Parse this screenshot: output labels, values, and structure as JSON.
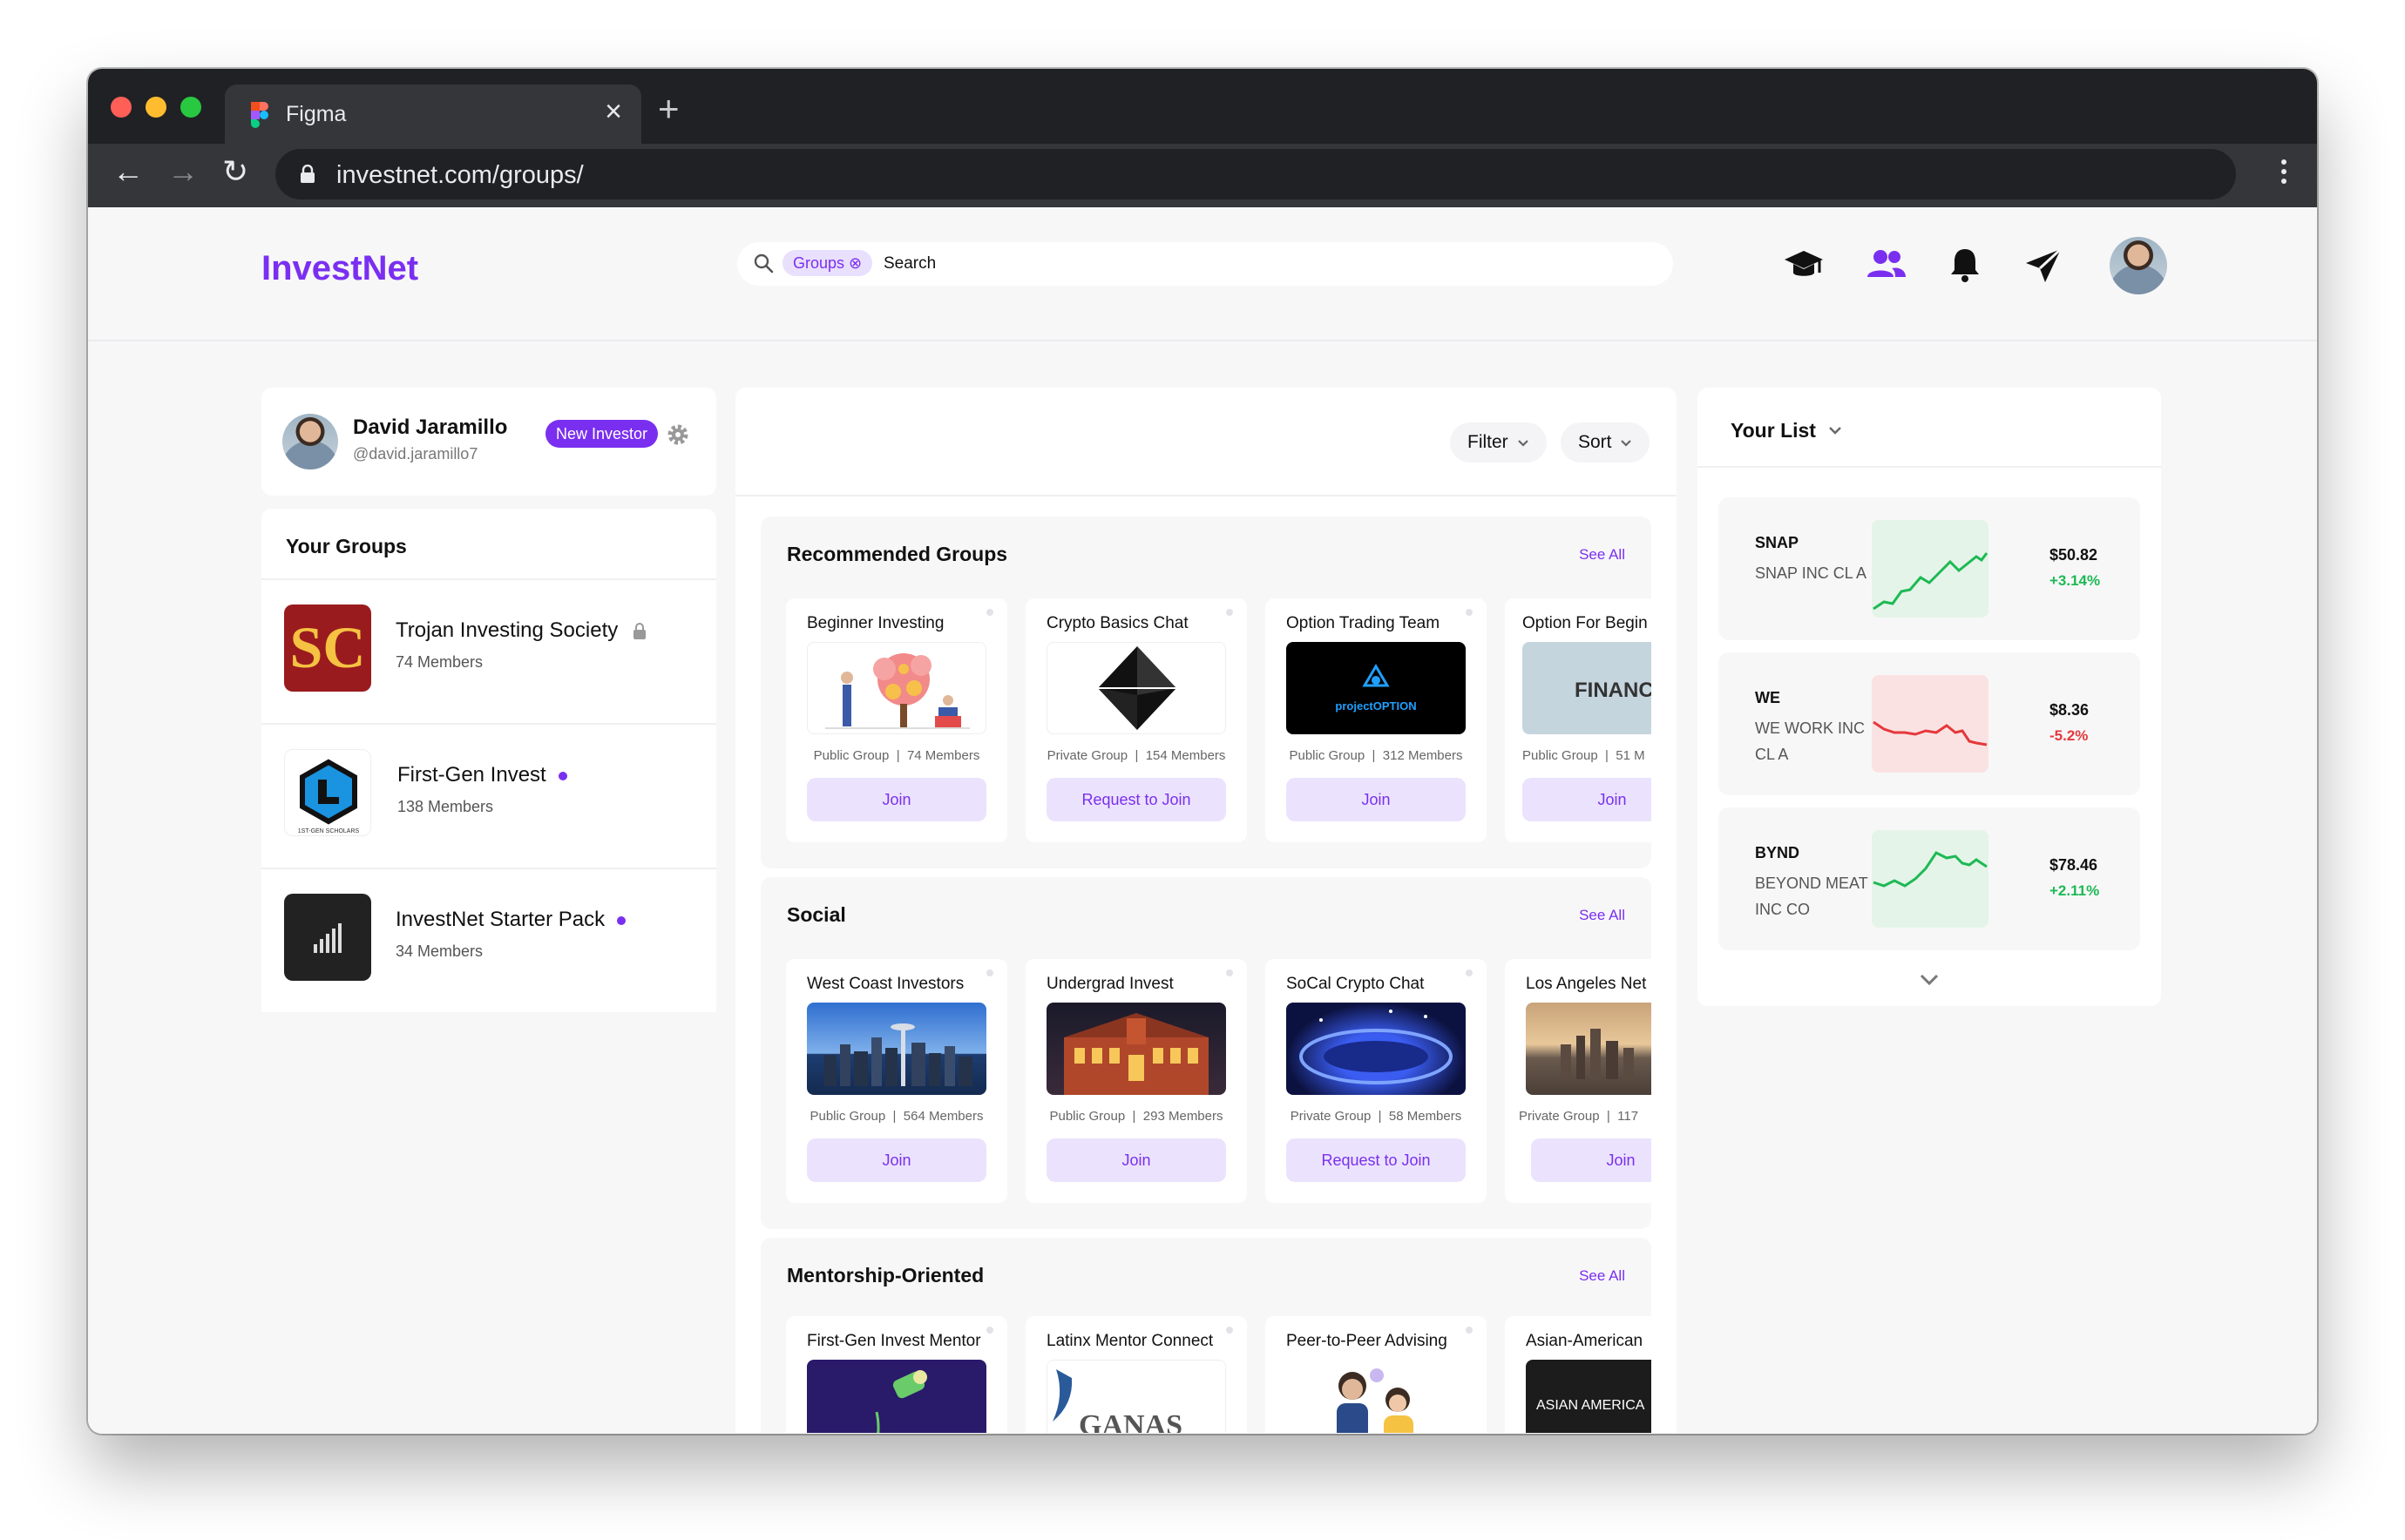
{
  "browser": {
    "tab_title": "Figma",
    "url": "investnet.com/groups/",
    "close_glyph": "×",
    "newtab_glyph": "+",
    "back_glyph": "←",
    "forward_glyph": "→",
    "reload_glyph": "↻"
  },
  "app": {
    "logo": "InvestNet",
    "brand_color": "#7a2ff0"
  },
  "search": {
    "chip_label": "Groups ⊗",
    "placeholder": "Search"
  },
  "nav_icons": [
    "graduation-cap-icon",
    "groups-icon",
    "bell-icon",
    "send-icon",
    "user-avatar"
  ],
  "profile": {
    "name": "David Jaramillo",
    "handle": "@david.jaramillo7",
    "badge": "New Investor"
  },
  "your_groups": {
    "title": "Your Groups",
    "items": [
      {
        "name": "Trojan Investing Society",
        "members": "74 Members"
      },
      {
        "name": "First-Gen Invest",
        "members": "138 Members"
      },
      {
        "name": "InvestNet Starter Pack",
        "members": "34 Members"
      }
    ]
  },
  "controls": {
    "filter": "Filter",
    "sort": "Sort"
  },
  "sections": [
    {
      "title": "Recommended Groups",
      "see_all": "See All",
      "cards": [
        {
          "title": "Beginner Investing",
          "type": "Public Group",
          "members": "74 Members",
          "button": "Join"
        },
        {
          "title": "Crypto Basics Chat",
          "type": "Private Group",
          "members": "154 Members",
          "button": "Request to Join"
        },
        {
          "title": "Option Trading Team",
          "type": "Public Group",
          "members": "312 Members",
          "button": "Join",
          "image_text": "projectOPTION"
        },
        {
          "title": "Option For Begin",
          "type": "Public Group",
          "members": "51 M",
          "button": "Join",
          "image_text": "FINANCE"
        }
      ]
    },
    {
      "title": "Social",
      "see_all": "See All",
      "cards": [
        {
          "title": "West Coast Investors",
          "type": "Public Group",
          "members": "564 Members",
          "button": "Join"
        },
        {
          "title": "Undergrad Invest",
          "type": "Public Group",
          "members": "293 Members",
          "button": "Join"
        },
        {
          "title": "SoCal Crypto Chat",
          "type": "Private Group",
          "members": "58 Members",
          "button": "Request to Join"
        },
        {
          "title": "Los Angeles Net",
          "type": "Private Group",
          "members": "117",
          "button": "Join"
        }
      ]
    },
    {
      "title": "Mentorship-Oriented",
      "see_all": "See All",
      "cards": [
        {
          "title": "First-Gen Invest Mentor"
        },
        {
          "title": "Latinx Mentor Connect",
          "image_text": "GANAS"
        },
        {
          "title": "Peer-to-Peer Advising"
        },
        {
          "title": "Asian-American",
          "image_text": "ASIAN AMERICA"
        }
      ]
    }
  ],
  "watchlist": {
    "title": "Your List",
    "stocks": [
      {
        "ticker": "SNAP",
        "name": "SNAP INC CL A",
        "price": "$50.82",
        "change": "+3.14%",
        "trend": "up"
      },
      {
        "ticker": "WE",
        "name": "WE WORK INC CL A",
        "price": "$8.36",
        "change": "-5.2%",
        "trend": "down"
      },
      {
        "ticker": "BYND",
        "name": "BEYOND MEAT INC CO",
        "price": "$78.46",
        "change": "+2.11%",
        "trend": "up"
      }
    ],
    "up_color": "#1db954",
    "down_color": "#e5383b"
  }
}
